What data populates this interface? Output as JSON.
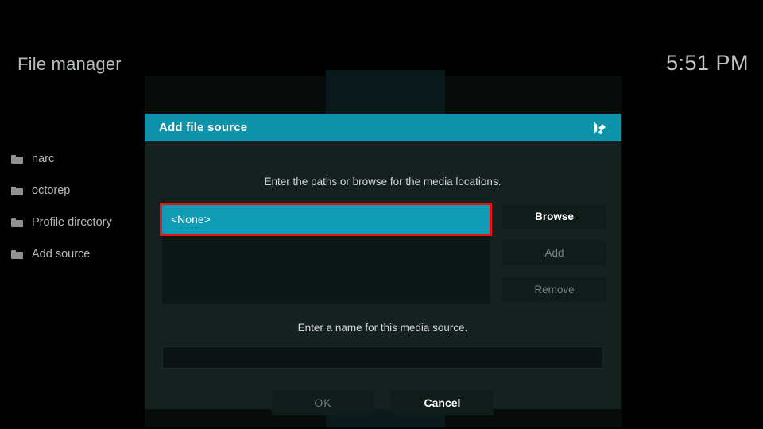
{
  "background": {
    "page_title": "File manager",
    "clock": "5:51 PM",
    "sidebar": {
      "items": [
        {
          "label": "narc",
          "icon": "folder-icon"
        },
        {
          "label": "octorep",
          "icon": "folder-icon"
        },
        {
          "label": "Profile directory",
          "icon": "folder-icon"
        },
        {
          "label": "Add source",
          "icon": "folder-icon"
        }
      ]
    }
  },
  "dialog": {
    "title": "Add file source",
    "logo_icon": "kodi-logo-icon",
    "paths_hint": "Enter the paths or browse for the media locations.",
    "path_list": [
      {
        "label": "<None>",
        "selected": true
      }
    ],
    "side_buttons": [
      {
        "label": "Browse",
        "enabled": true
      },
      {
        "label": "Add",
        "enabled": false
      },
      {
        "label": "Remove",
        "enabled": false
      }
    ],
    "name_hint": "Enter a name for this media source.",
    "name_input": {
      "value": "",
      "placeholder": ""
    },
    "bottom_buttons": [
      {
        "label": "OK",
        "enabled": false
      },
      {
        "label": "Cancel",
        "enabled": true
      }
    ]
  },
  "colors": {
    "accent_teal": "#0f93ab",
    "selection_teal": "#0f9bb3",
    "dialog_bg": "#14211f",
    "highlight_red": "#ee1111",
    "screen_bg": "#000000",
    "text_primary": "#ffffff",
    "text_muted": "#7b8284"
  }
}
